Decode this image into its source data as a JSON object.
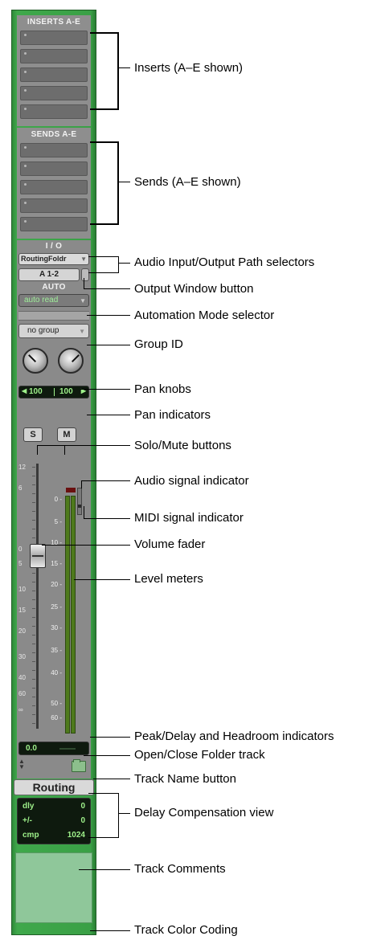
{
  "strip": {
    "inserts_header": "INSERTS A-E",
    "sends_header": "SENDS A-E",
    "io_header": "I / O",
    "input_path": "RoutingFoldr",
    "output_path": "A 1-2",
    "auto_header": "AUTO",
    "auto_mode": "auto read",
    "group": "no group",
    "pan_left": "100",
    "pan_right": "100",
    "solo": "S",
    "mute": "M",
    "fader_scale": [
      "12",
      "6",
      "0",
      "5",
      "10",
      "15",
      "20",
      "30",
      "40",
      "60",
      "∞"
    ],
    "meter_scale": [
      "0",
      "5",
      "10",
      "15",
      "20",
      "25",
      "30",
      "35",
      "40",
      "50",
      "60"
    ],
    "peak_value": "0.0",
    "track_name": "Routing",
    "delay": {
      "dly_label": "dly",
      "dly_value": "0",
      "pm_label": "+/-",
      "pm_value": "0",
      "cmp_label": "cmp",
      "cmp_value": "1024"
    },
    "colors": {
      "track": "#3aa046",
      "meter": "#4e7a1c",
      "readout": "#0e1a0e"
    }
  },
  "callouts": {
    "inserts": "Inserts (A–E shown)",
    "sends": "Sends (A–E shown)",
    "io_selectors": "Audio Input/Output Path selectors",
    "output_window": "Output Window button",
    "automation": "Automation Mode selector",
    "group_id": "Group ID",
    "pan_knobs": "Pan knobs",
    "pan_indicators": "Pan indicators",
    "solo_mute": "Solo/Mute buttons",
    "audio_signal": "Audio signal indicator",
    "midi_signal": "MIDI signal indicator",
    "volume_fader": "Volume fader",
    "level_meters": "Level meters",
    "peak_delay": "Peak/Delay and Headroom indicators",
    "folder": "Open/Close Folder track",
    "track_name": "Track Name button",
    "delay_comp": "Delay Compensation view",
    "comments": "Track Comments",
    "color_coding": "Track Color Coding"
  }
}
